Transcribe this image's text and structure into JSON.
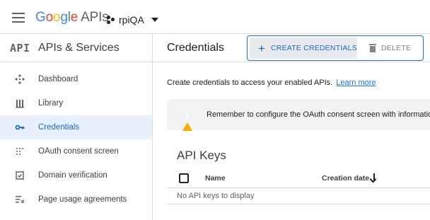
{
  "topbar": {
    "logo_google_letters": [
      "G",
      "o",
      "o",
      "g",
      "l",
      "e"
    ],
    "logo_suffix": " APIs",
    "project_name": "rpiQA"
  },
  "sidebar": {
    "mark": "API",
    "title": "APIs & Services",
    "items": [
      {
        "label": "Dashboard",
        "icon": "dashboard-icon",
        "active": false
      },
      {
        "label": "Library",
        "icon": "library-icon",
        "active": false
      },
      {
        "label": "Credentials",
        "icon": "key-icon",
        "active": true
      },
      {
        "label": "OAuth consent screen",
        "icon": "consent-grid-icon",
        "active": false
      },
      {
        "label": "Domain verification",
        "icon": "domain-check-icon",
        "active": false
      },
      {
        "label": "Page usage agreements",
        "icon": "settings-list-icon",
        "active": false
      }
    ]
  },
  "main": {
    "title": "Credentials",
    "create_button": {
      "plus": "+",
      "label": "CREATE CREDENTIALS"
    },
    "delete_button": {
      "label": "DELETE"
    },
    "intro_text": "Create credentials to access your enabled APIs.",
    "learn_more": "Learn more",
    "warning_text": "Remember to configure the OAuth consent screen with information about your application.",
    "section_title": "API Keys",
    "table": {
      "columns": [
        "Name",
        "Creation date"
      ],
      "empty_text": "No API keys to display"
    }
  },
  "colors": {
    "accent": "#1a73e8",
    "active_bg": "#e8f0fe",
    "warning": "#f9ab00"
  }
}
